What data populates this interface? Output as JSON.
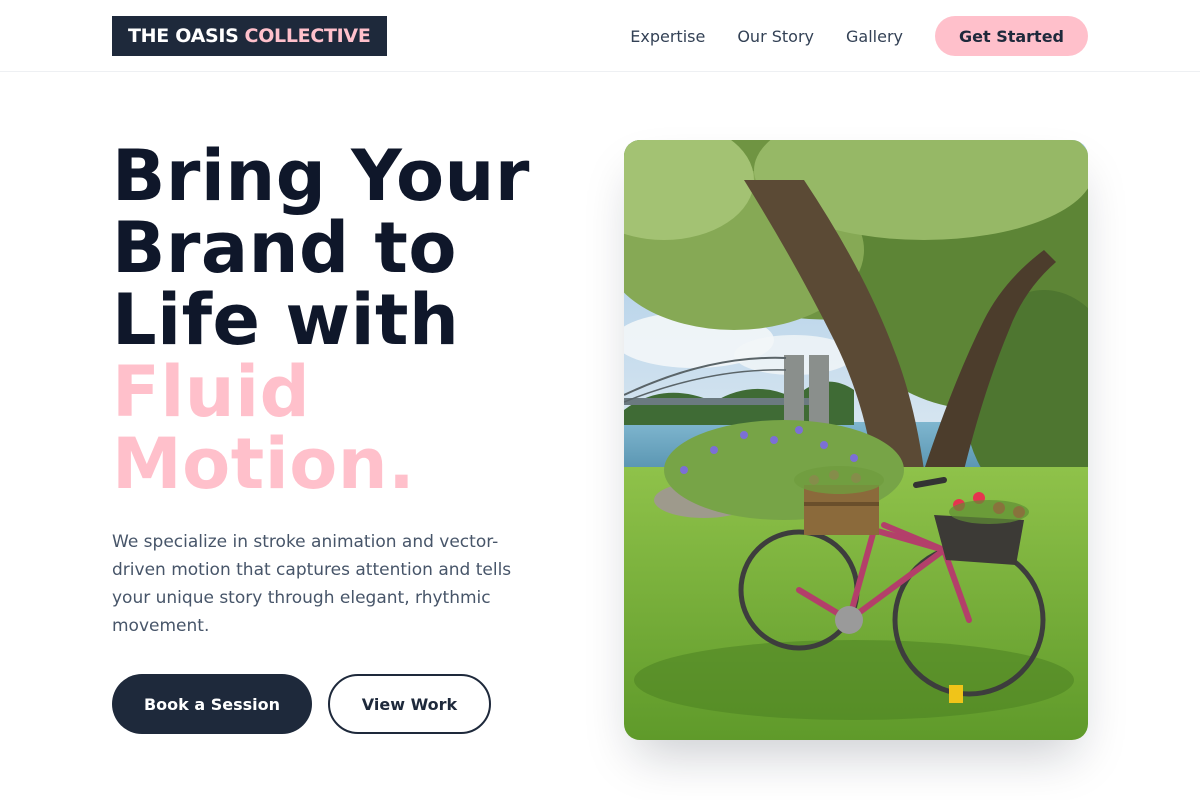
{
  "nav": {
    "logo_primary": "THE OASIS",
    "logo_accent": "COLLECTIVE",
    "links": [
      {
        "label": "Expertise"
      },
      {
        "label": "Our Story"
      },
      {
        "label": "Gallery"
      }
    ],
    "cta_label": "Get Started"
  },
  "hero": {
    "headline_lines": [
      "Bring Your",
      "Brand to",
      "Life with"
    ],
    "headline_accent_lines": [
      "Fluid",
      "Motion."
    ],
    "description": "We specialize in stroke animation and vector-driven motion that captures attention and tells your unique story through elegant, rhythmic movement.",
    "primary_button": "Book a Session",
    "secondary_button": "View Work",
    "image_subject": "bicycle-with-flower-baskets-under-tree-by-river"
  },
  "colors": {
    "accent": "#ffc0cb",
    "dark": "#1e293b",
    "heading": "#0f172a",
    "body_text": "#475569"
  }
}
